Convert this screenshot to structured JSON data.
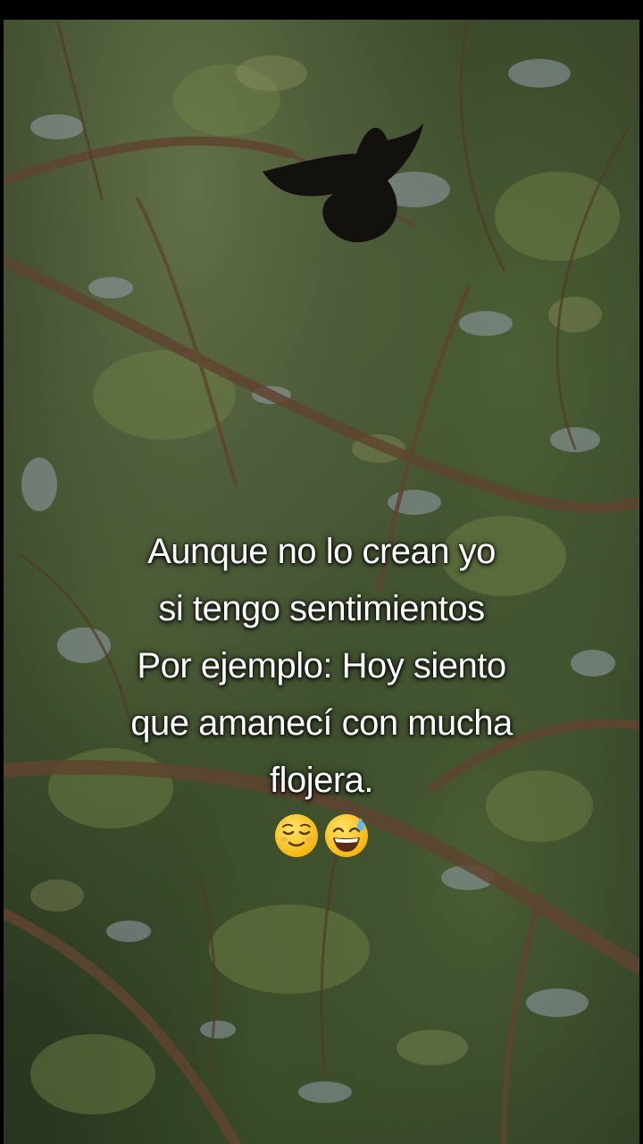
{
  "caption": {
    "lines": [
      "Aunque no lo crean yo",
      "si tengo sentimientos",
      "Por ejemplo: Hoy siento",
      "que amanecí con mucha",
      "flojera."
    ],
    "emojis": [
      "relieved-face-icon",
      "grinning-face-with-sweat-icon"
    ]
  }
}
